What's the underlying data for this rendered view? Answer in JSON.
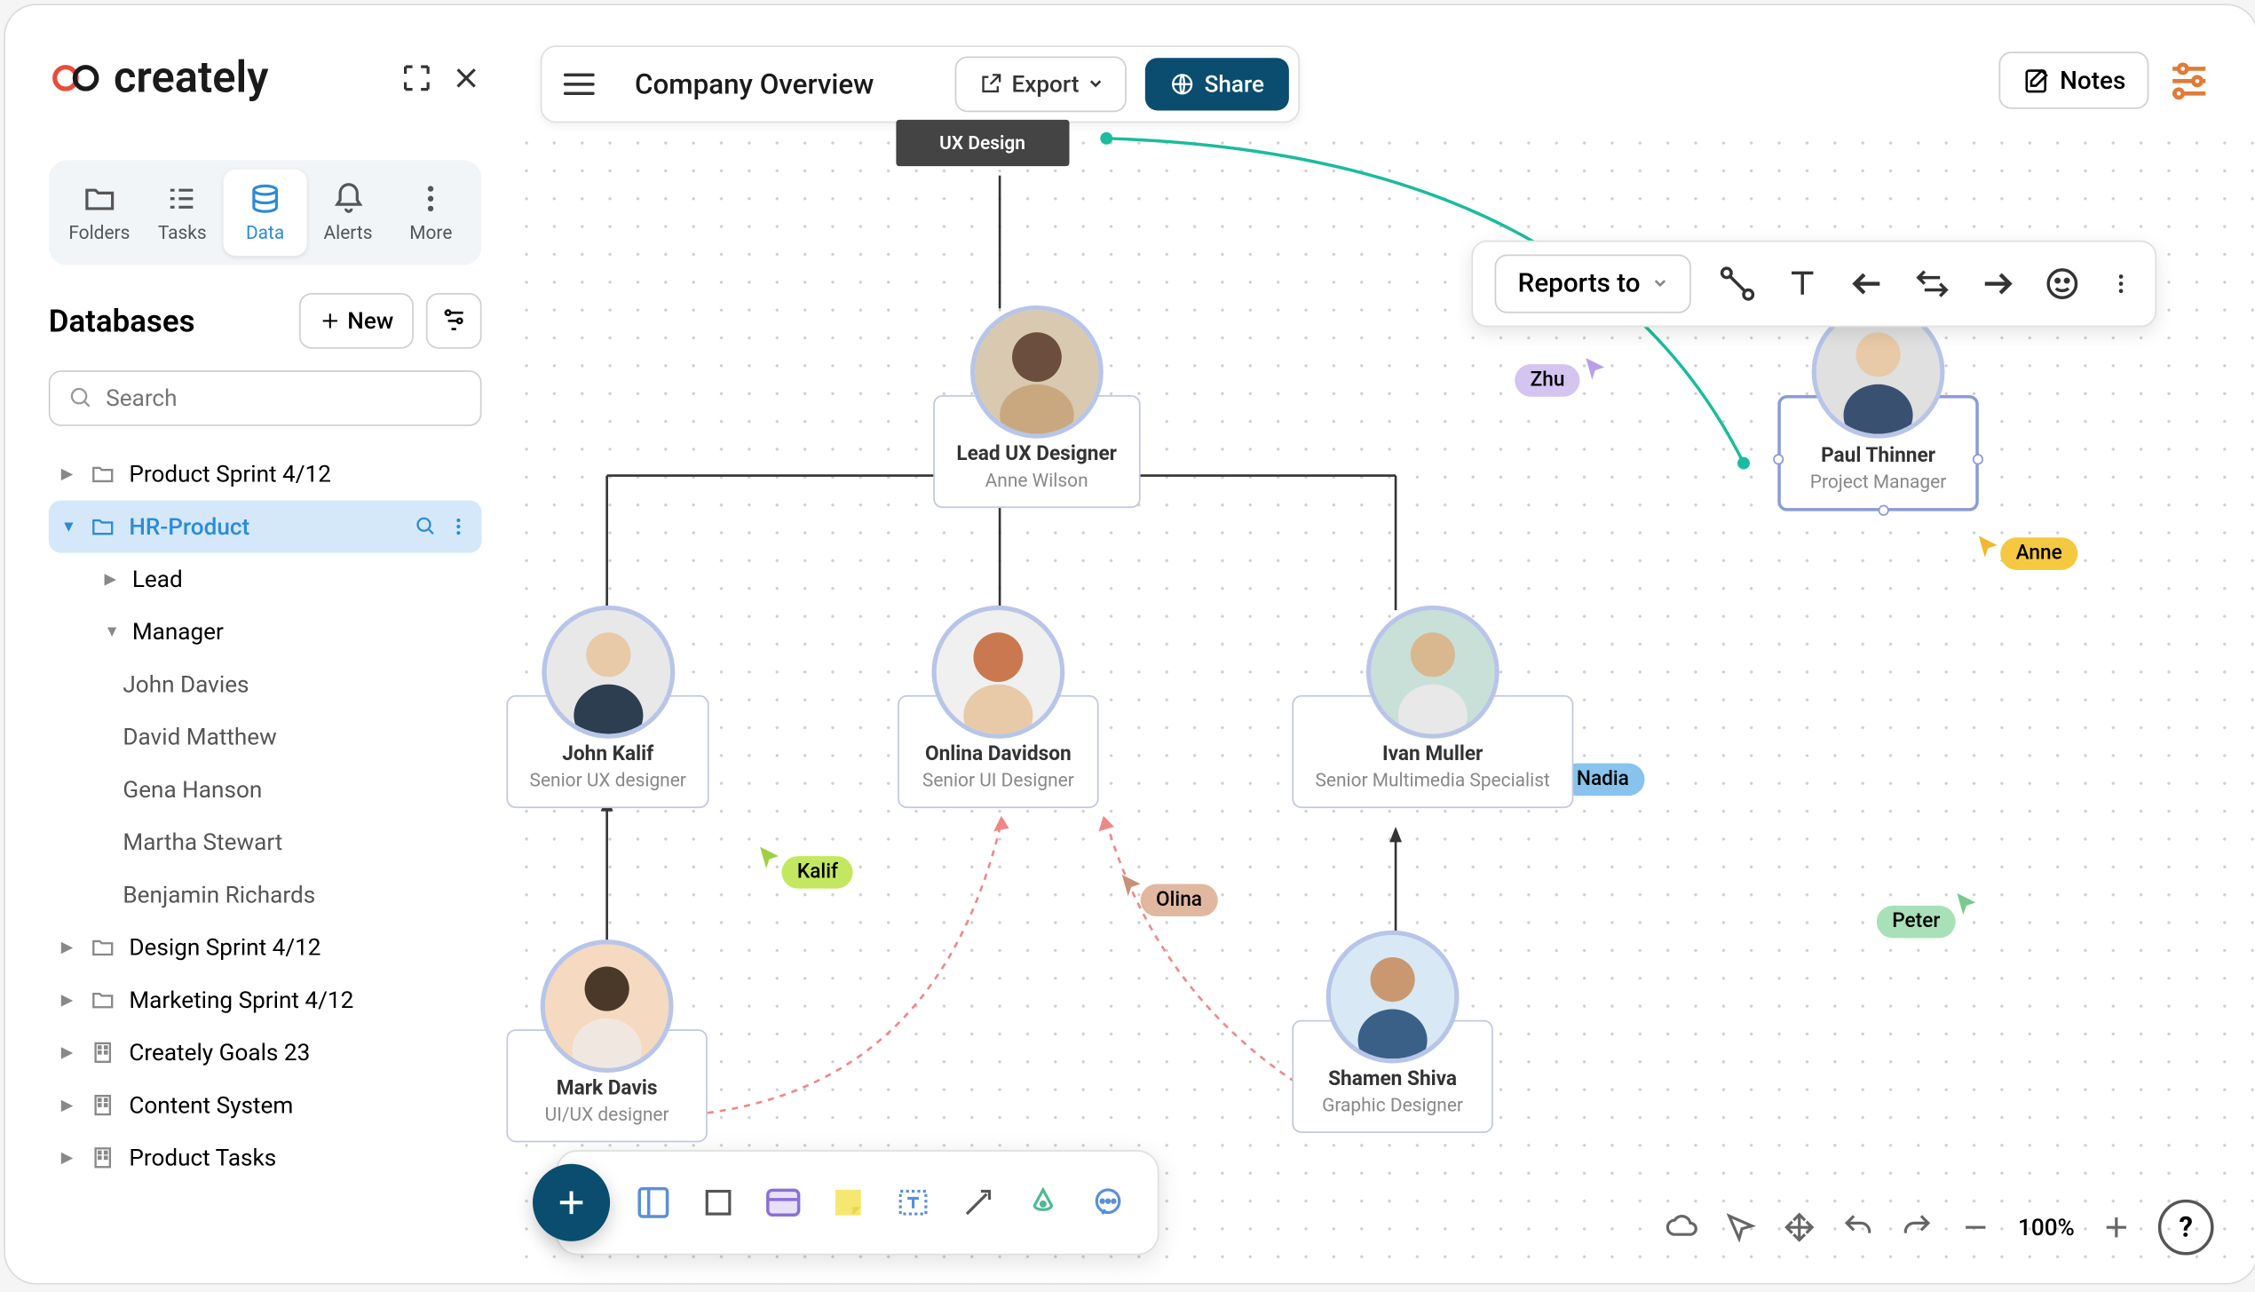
{
  "brand": "creately",
  "document": {
    "title": "Company Overview"
  },
  "header": {
    "export_label": "Export",
    "share_label": "Share",
    "notes_label": "Notes"
  },
  "sidebar": {
    "tabs": [
      {
        "label": "Folders"
      },
      {
        "label": "Tasks"
      },
      {
        "label": "Data"
      },
      {
        "label": "Alerts"
      },
      {
        "label": "More"
      }
    ],
    "section_title": "Databases",
    "new_label": "New",
    "search_placeholder": "Search",
    "tree": [
      {
        "label": "Product Sprint 4/12",
        "icon": "folder"
      },
      {
        "label": "HR-Product",
        "icon": "folder",
        "selected": true,
        "expanded": true
      },
      {
        "label": "Lead",
        "child": true
      },
      {
        "label": "Manager",
        "child": true,
        "expanded": true
      },
      {
        "label": "John Davies",
        "leaf": true
      },
      {
        "label": "David Matthew",
        "leaf": true
      },
      {
        "label": "Gena Hanson",
        "leaf": true
      },
      {
        "label": "Martha Stewart",
        "leaf": true
      },
      {
        "label": "Benjamin Richards",
        "leaf": true
      },
      {
        "label": "Design Sprint 4/12",
        "icon": "folder"
      },
      {
        "label": "Marketing Sprint 4/12",
        "icon": "folder"
      },
      {
        "label": "Creately Goals 23",
        "icon": "building"
      },
      {
        "label": "Content System",
        "icon": "building"
      },
      {
        "label": "Product Tasks",
        "icon": "building"
      }
    ]
  },
  "canvas": {
    "department": "UX Design",
    "nodes": [
      {
        "id": "anne",
        "title": "Lead UX Designer",
        "name": "Anne Wilson"
      },
      {
        "id": "john",
        "title": "John Kalif",
        "name": "Senior UX designer"
      },
      {
        "id": "onlina",
        "title": "Onlina Davidson",
        "name": "Senior UI Designer"
      },
      {
        "id": "ivan",
        "title": "Ivan Muller",
        "name": "Senior Multimedia Specialist"
      },
      {
        "id": "paul",
        "title": "Paul Thinner",
        "name": "Project Manager"
      },
      {
        "id": "mark",
        "title": "Mark Davis",
        "name": "UI/UX designer"
      },
      {
        "id": "shamen",
        "title": "Shamen Shiva",
        "name": "Graphic Designer"
      }
    ]
  },
  "connector_toolbar": {
    "relation": "Reports to"
  },
  "collaborators": [
    {
      "name": "Zhu",
      "color": "#c9b8f0"
    },
    {
      "name": "Nadia",
      "color": "#87c3ec"
    },
    {
      "name": "Anne",
      "color": "#f5c842"
    },
    {
      "name": "Kalif",
      "color": "#c3e860"
    },
    {
      "name": "Olina",
      "color": "#d9a890"
    },
    {
      "name": "Peter",
      "color": "#a8e0b8"
    }
  ],
  "zoom": "100%"
}
